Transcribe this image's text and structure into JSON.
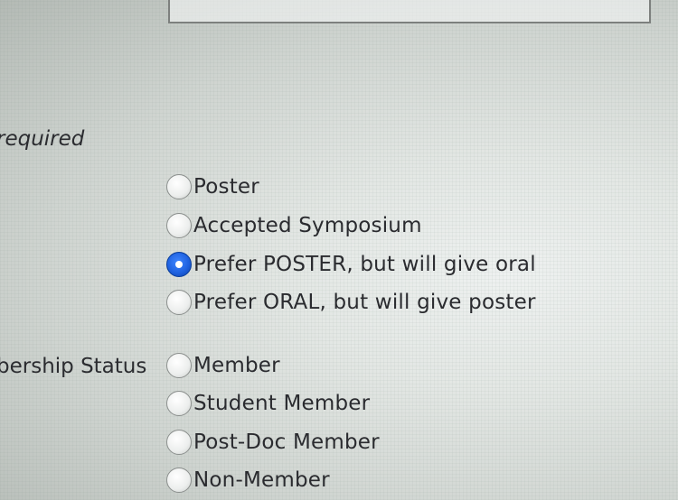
{
  "labels": {
    "required": "required",
    "membership_status": "bership Status"
  },
  "presentation_type": {
    "options": [
      {
        "label": "Poster",
        "checked": false
      },
      {
        "label": "Accepted Symposium",
        "checked": false
      },
      {
        "label": "Prefer POSTER, but will give oral",
        "checked": true
      },
      {
        "label": "Prefer ORAL, but will give poster",
        "checked": false
      }
    ]
  },
  "membership": {
    "options": [
      {
        "label": "Member",
        "checked": false
      },
      {
        "label": "Student Member",
        "checked": false
      },
      {
        "label": "Post-Doc Member",
        "checked": false
      },
      {
        "label": "Non-Member",
        "checked": false
      }
    ]
  },
  "colors": {
    "selected_radio": "#1f62e0"
  }
}
